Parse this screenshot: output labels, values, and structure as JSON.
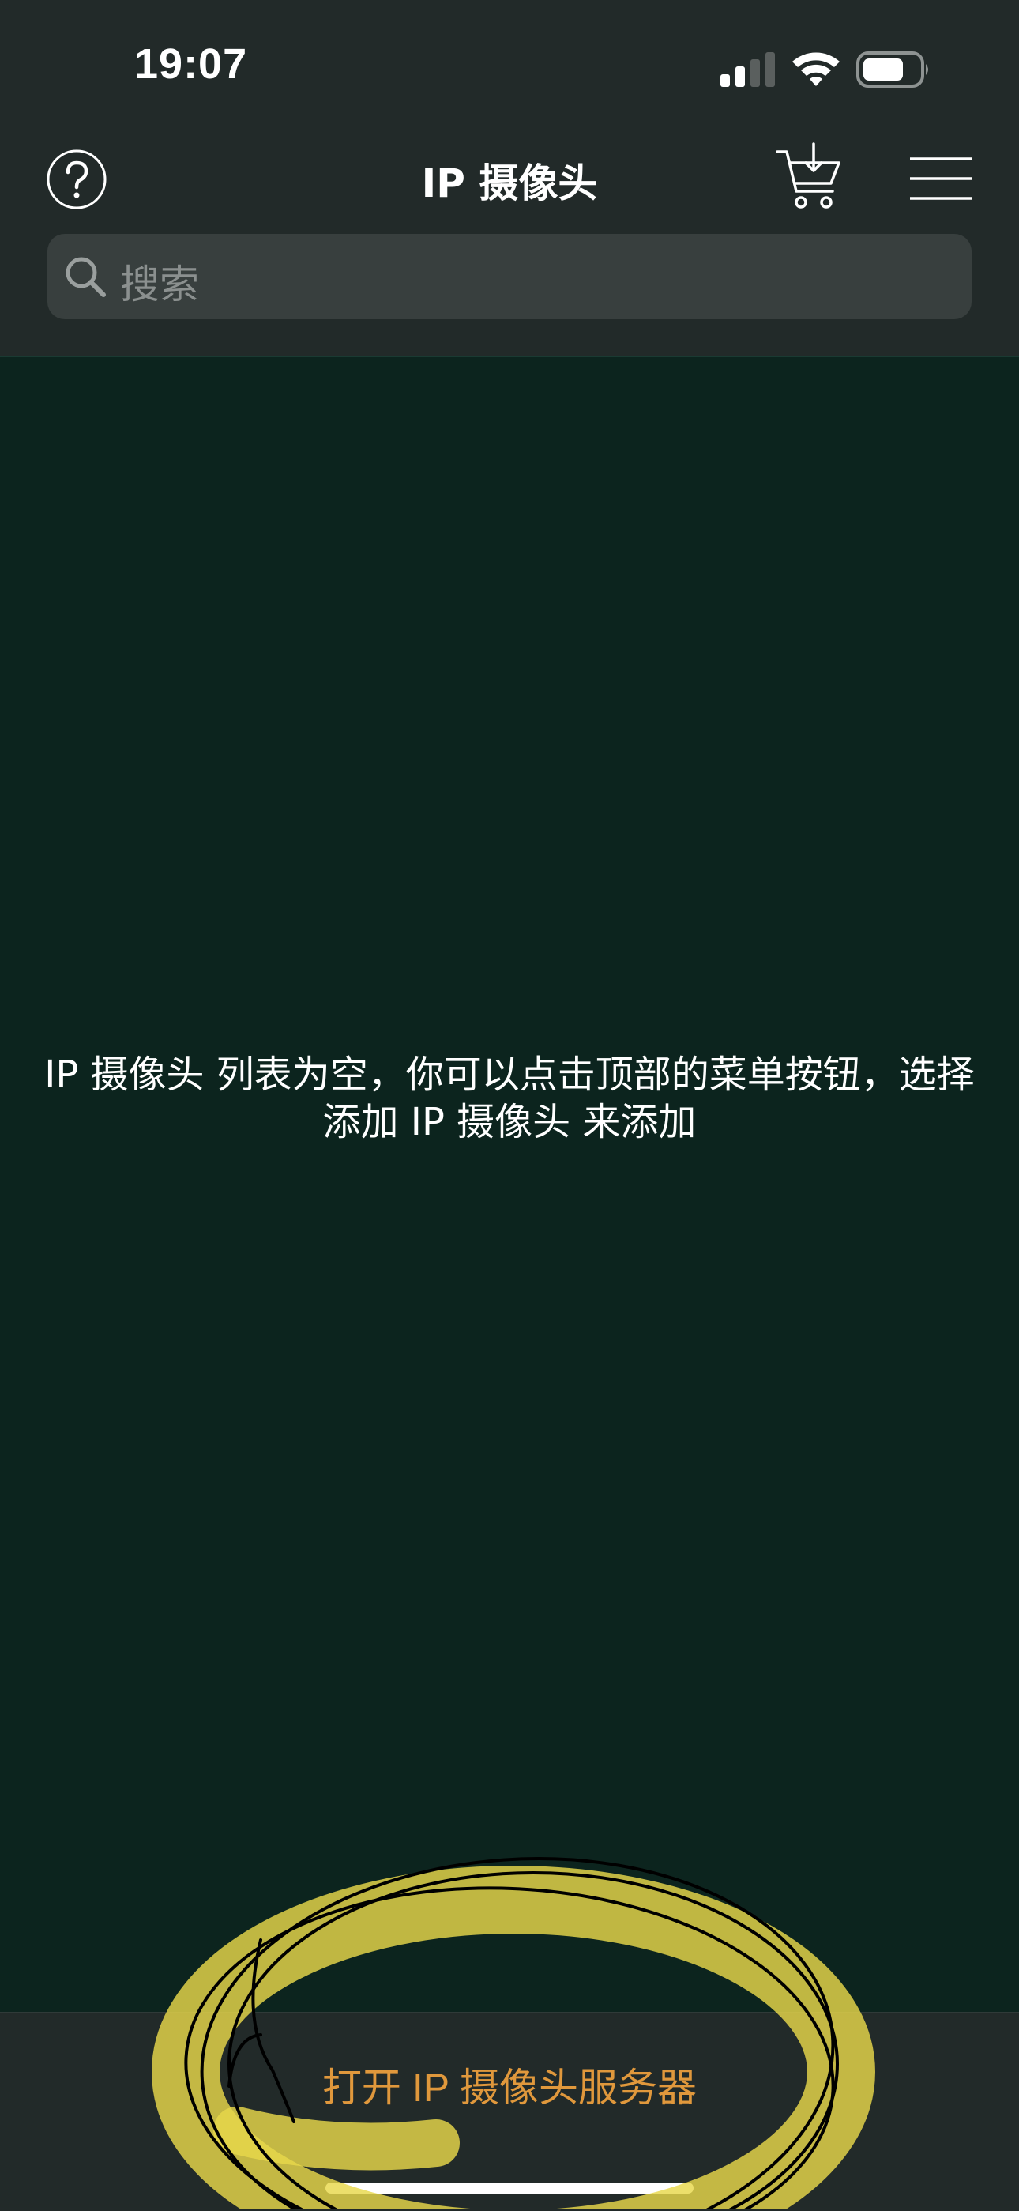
{
  "status_bar": {
    "time": "19:07",
    "icons": [
      "cellular-signal-icon",
      "wifi-icon",
      "battery-icon"
    ]
  },
  "nav": {
    "title": "IP 摄像头",
    "icons": {
      "left": "question-circle-icon",
      "right": [
        "cart-download-icon",
        "hamburger-menu-icon"
      ]
    }
  },
  "search": {
    "placeholder": "搜索",
    "icon": "search-icon"
  },
  "main": {
    "empty_message": "IP 摄像头 列表为空，你可以点击顶部的菜单按钮，选择\n添加 IP 摄像头 来添加"
  },
  "bottom": {
    "server_button_label": "打开 IP 摄像头服务器"
  },
  "colors": {
    "header_bg": "#222a29",
    "content_bg": "#0c241e",
    "search_bg": "#383f3e",
    "accent": "#e0983c",
    "annotation_highlight": "#e8d84a",
    "annotation_ink": "#000000"
  }
}
